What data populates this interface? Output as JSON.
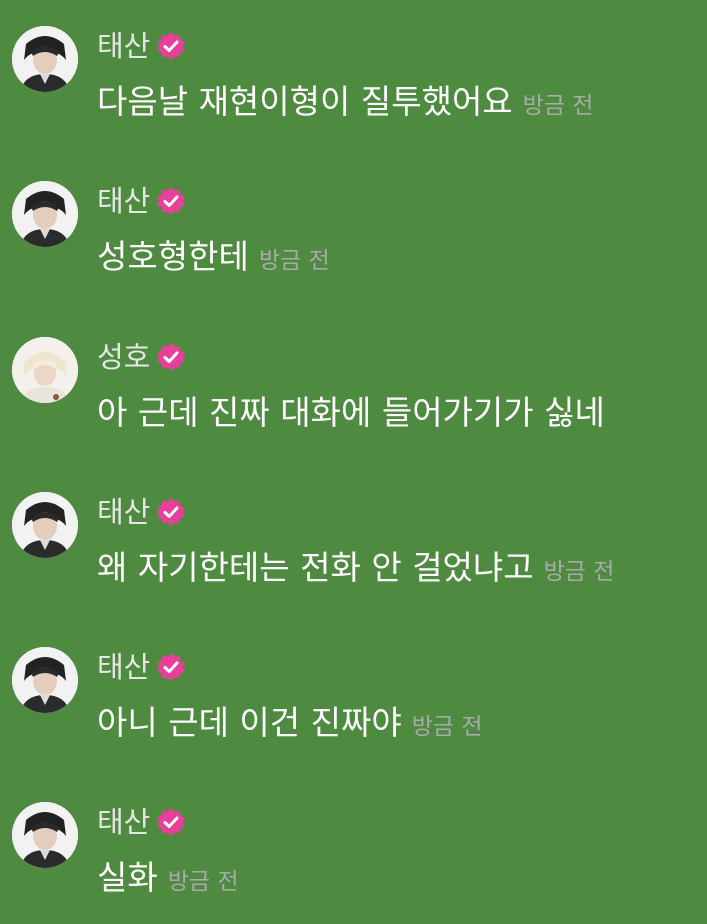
{
  "colors": {
    "background": "#4e8a40",
    "name_text": "#e6e6e6",
    "message_text": "#ffffff",
    "timestamp_text": "#aaaaaa",
    "verified_badge": "#e8409a"
  },
  "icons": {
    "avatar_taesan": "avatar-taesan-icon",
    "avatar_sungho": "avatar-sungho-icon",
    "verified": "verified-badge-icon"
  },
  "messages": [
    {
      "name": "태산",
      "text": "다음날 재현이형이 질투했어요",
      "time": "방금 전"
    },
    {
      "name": "태산",
      "text": "성호형한테",
      "time": "방금 전"
    },
    {
      "name": "성호",
      "text": "아 근데 진짜 대화에 들어가기가 싫네",
      "time": ""
    },
    {
      "name": "태산",
      "text": "왜 자기한테는 전화 안 걸었냐고",
      "time": "방금 전"
    },
    {
      "name": "태산",
      "text": "아니 근데 이건 진짜야",
      "time": "방금 전"
    },
    {
      "name": "태산",
      "text": "실화",
      "time": "방금 전"
    }
  ]
}
